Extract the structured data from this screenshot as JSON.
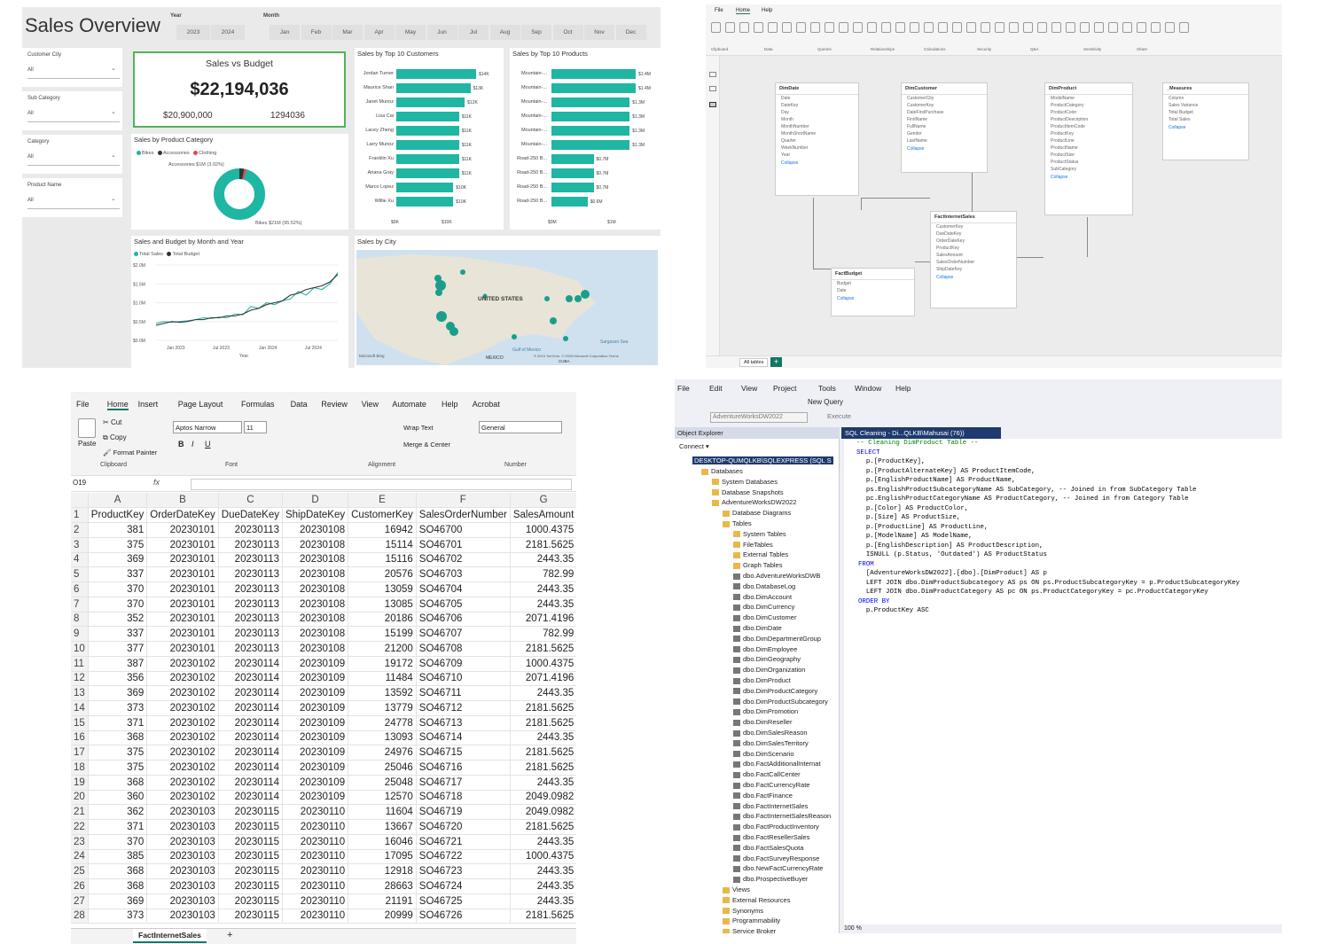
{
  "powerbi": {
    "title": "Sales Overview",
    "slicers": {
      "year_label": "Year",
      "years": [
        "2023",
        "2024"
      ],
      "month_label": "Month",
      "months": [
        "Jan",
        "Feb",
        "Mar",
        "Apr",
        "May",
        "Jun",
        "Jul",
        "Aug",
        "Sep",
        "Oct",
        "Nov",
        "Dec"
      ],
      "filters": [
        {
          "label": "Customer City",
          "value": "All"
        },
        {
          "label": "Sub Category",
          "value": "All"
        },
        {
          "label": "Category",
          "value": "All"
        },
        {
          "label": "Product Name",
          "value": "All"
        }
      ]
    },
    "kpi": {
      "title": "Sales vs Budget",
      "sales": "$22,194,036",
      "budget": "$20,900,000",
      "budget_raw": "1294036"
    },
    "donut": {
      "title": "Sales by Product Category",
      "legend": [
        "Bikes",
        "Accessories",
        "Clothing"
      ],
      "legend_colors": [
        "#1fb6a3",
        "#333333",
        "#e5484d"
      ],
      "label_acc": "Accessories $1M (3.02%)",
      "label_bikes": "Bikes $21M (95.52%)"
    },
    "customers": {
      "title": "Sales by Top 10 Customers",
      "names": [
        "Jordan Turner",
        "Maurice Shan",
        "Janet Munoz",
        "Lisa Cai",
        "Lacey Zheng",
        "Larry Munoz",
        "Franklin Xu",
        "Ariana Gray",
        "Marco Lopez",
        "Willie Xu"
      ],
      "values_k": [
        14,
        13,
        12,
        11,
        11,
        11,
        11,
        11,
        10,
        10
      ],
      "labels": [
        "$14K",
        "$13K",
        "$12K",
        "$11K",
        "$11K",
        "$11K",
        "$11K",
        "$11K",
        "$10K",
        "$10K"
      ],
      "ticks": [
        "$0K",
        "$10K"
      ]
    },
    "products": {
      "title": "Sales by Top 10 Products",
      "names": [
        "Mountain-...",
        "Mountain-...",
        "Mountain-...",
        "Mountain-...",
        "Mountain-...",
        "Mountain-...",
        "Road-250 B...",
        "Road-250 B...",
        "Road-250 B...",
        "Road-250 B..."
      ],
      "values_m": [
        1.4,
        1.4,
        1.3,
        1.3,
        1.3,
        1.3,
        0.7,
        0.7,
        0.7,
        0.6
      ],
      "labels": [
        "$1.4M",
        "$1.4M",
        "$1.3M",
        "$1.3M",
        "$1.3M",
        "$1.3M",
        "$0.7M",
        "$0.7M",
        "$0.7M",
        "$0.6M"
      ],
      "ticks": [
        "$0M",
        "$1M"
      ]
    },
    "line": {
      "title": "Sales and Budget by Month and Year",
      "legend": [
        "Total Sales",
        "Total Budget"
      ],
      "legend_colors": [
        "#1fb6a3",
        "#333333"
      ],
      "y_ticks": [
        "$2.0M",
        "$1.5M",
        "$1.0M",
        "$0.5M",
        "$0.0M"
      ],
      "x_ticks": [
        "Jan 2023",
        "Jul 2023",
        "Jan 2024",
        "Jul 2024"
      ],
      "xlabel": "Year"
    },
    "map": {
      "title": "Sales by City",
      "country": "UNITED STATES",
      "gulf": "Gulf of Mexico",
      "mexico": "MEXICO",
      "cuba": "CUBA",
      "sea": "Sargasso Sea",
      "credit": "© 2024 TomTom, © 2025 Microsoft Corporation  Terms",
      "brand": "Microsoft Bing"
    }
  },
  "chart_data": [
    {
      "type": "bar",
      "title": "Sales by Top 10 Customers",
      "categories": [
        "Jordan Turner",
        "Maurice Shan",
        "Janet Munoz",
        "Lisa Cai",
        "Lacey Zheng",
        "Larry Munoz",
        "Franklin Xu",
        "Ariana Gray",
        "Marco Lopez",
        "Willie Xu"
      ],
      "values": [
        14,
        13,
        12,
        11,
        11,
        11,
        11,
        11,
        10,
        10
      ]
    },
    {
      "type": "bar",
      "title": "Sales by Top 10 Products",
      "values": [
        1.4,
        1.4,
        1.3,
        1.3,
        1.3,
        1.3,
        0.7,
        0.7,
        0.7,
        0.6
      ]
    },
    {
      "type": "line",
      "title": "Sales and Budget by Month and Year",
      "ylim": [
        0,
        2.0
      ],
      "series": [
        {
          "name": "Total Sales",
          "values": [
            0.45,
            0.5,
            0.48,
            0.5,
            0.52,
            0.55,
            0.6,
            0.58,
            0.62,
            0.6,
            0.7,
            0.68,
            0.9,
            0.85,
            1.0,
            0.95,
            1.05,
            1.1,
            1.3,
            1.2,
            1.4,
            1.35,
            1.5,
            1.8
          ]
        },
        {
          "name": "Total Budget",
          "values": [
            0.4,
            0.45,
            0.5,
            0.48,
            0.5,
            0.55,
            0.55,
            0.6,
            0.6,
            0.65,
            0.65,
            0.7,
            0.8,
            0.85,
            0.95,
            1.0,
            1.05,
            1.2,
            1.25,
            1.35,
            1.4,
            1.45,
            1.55,
            1.75
          ]
        }
      ]
    },
    {
      "type": "pie",
      "title": "Sales by Product Category",
      "categories": [
        "Bikes",
        "Accessories",
        "Clothing"
      ],
      "values": [
        95.52,
        3.02,
        1.46
      ]
    }
  ],
  "model": {
    "tabs": [
      "File",
      "Home",
      "Help"
    ],
    "groups": [
      "Clipboard",
      "Data",
      "Queries",
      "Relationships",
      "Calculations",
      "Security",
      "Q&A",
      "Sensitivity",
      "Share"
    ],
    "tables": [
      {
        "name": "DimDate",
        "fields": [
          "Date",
          "DateKey",
          "Day",
          "Month",
          "MonthNumber",
          "MonthShortName",
          "Quarter",
          "WeekNumber",
          "Year"
        ]
      },
      {
        "name": "DimCustomer",
        "fields": [
          "CustomerCity",
          "CustomerKey",
          "DateFirstPurchase",
          "FirstName",
          "FullName",
          "Gender",
          "LastName"
        ]
      },
      {
        "name": "DimProduct",
        "fields": [
          "ModelName",
          "ProductCategory",
          "ProductColor",
          "ProductDescription",
          "ProductItemCode",
          "ProductKey",
          "ProductLine",
          "ProductName",
          "ProductSize",
          "ProductStatus",
          "SubCategory"
        ]
      },
      {
        "name": "_Measures",
        "fields": [
          "Column",
          "Sales Variance",
          "Total Budget",
          "Total Sales"
        ]
      },
      {
        "name": "FactInternetSales",
        "fields": [
          "CustomerKey",
          "DueDateKey",
          "OrderDateKey",
          "ProductKey",
          "SalesAmount",
          "SalesOrderNumber",
          "ShipDateKey"
        ]
      },
      {
        "name": "FactBudget",
        "fields": [
          "Budget",
          "Date"
        ]
      }
    ],
    "collapse": "Collapse",
    "footer_tab": "All tables"
  },
  "excel": {
    "menu": [
      "File",
      "Home",
      "Insert",
      "Page Layout",
      "Formulas",
      "Data",
      "Review",
      "View",
      "Automate",
      "Help",
      "Acrobat"
    ],
    "font": "Aptos Narrow",
    "size": "11",
    "numfmt": "General",
    "cellref": "O19",
    "clipboard": [
      "Cut",
      "Copy",
      "Format Painter",
      "Paste",
      "Clipboard"
    ],
    "groups": [
      "Font",
      "Alignment",
      "Number"
    ],
    "wrap": "Wrap Text",
    "merge": "Merge & Center",
    "cols": [
      "A",
      "B",
      "C",
      "D",
      "E",
      "F",
      "G"
    ],
    "headers": [
      "ProductKey",
      "OrderDateKey",
      "DueDateKey",
      "ShipDateKey",
      "CustomerKey",
      "SalesOrderNumber",
      "SalesAmount"
    ],
    "rows": [
      [
        "381",
        "20230101",
        "20230113",
        "20230108",
        "16942",
        "SO46700",
        "1000.4375"
      ],
      [
        "375",
        "20230101",
        "20230113",
        "20230108",
        "15114",
        "SO46701",
        "2181.5625"
      ],
      [
        "369",
        "20230101",
        "20230113",
        "20230108",
        "15116",
        "SO46702",
        "2443.35"
      ],
      [
        "337",
        "20230101",
        "20230113",
        "20230108",
        "20576",
        "SO46703",
        "782.99"
      ],
      [
        "370",
        "20230101",
        "20230113",
        "20230108",
        "13059",
        "SO46704",
        "2443.35"
      ],
      [
        "370",
        "20230101",
        "20230113",
        "20230108",
        "13085",
        "SO46705",
        "2443.35"
      ],
      [
        "352",
        "20230101",
        "20230113",
        "20230108",
        "20186",
        "SO46706",
        "2071.4196"
      ],
      [
        "337",
        "20230101",
        "20230113",
        "20230108",
        "15199",
        "SO46707",
        "782.99"
      ],
      [
        "377",
        "20230101",
        "20230113",
        "20230108",
        "21200",
        "SO46708",
        "2181.5625"
      ],
      [
        "387",
        "20230102",
        "20230114",
        "20230109",
        "19172",
        "SO46709",
        "1000.4375"
      ],
      [
        "356",
        "20230102",
        "20230114",
        "20230109",
        "11484",
        "SO46710",
        "2071.4196"
      ],
      [
        "369",
        "20230102",
        "20230114",
        "20230109",
        "13592",
        "SO46711",
        "2443.35"
      ],
      [
        "373",
        "20230102",
        "20230114",
        "20230109",
        "13779",
        "SO46712",
        "2181.5625"
      ],
      [
        "371",
        "20230102",
        "20230114",
        "20230109",
        "24778",
        "SO46713",
        "2181.5625"
      ],
      [
        "368",
        "20230102",
        "20230114",
        "20230109",
        "13093",
        "SO46714",
        "2443.35"
      ],
      [
        "375",
        "20230102",
        "20230114",
        "20230109",
        "24976",
        "SO46715",
        "2181.5625"
      ],
      [
        "375",
        "20230102",
        "20230114",
        "20230109",
        "25046",
        "SO46716",
        "2181.5625"
      ],
      [
        "368",
        "20230102",
        "20230114",
        "20230109",
        "25048",
        "SO46717",
        "2443.35"
      ],
      [
        "360",
        "20230102",
        "20230114",
        "20230109",
        "12570",
        "SO46718",
        "2049.0982"
      ],
      [
        "362",
        "20230103",
        "20230115",
        "20230110",
        "11604",
        "SO46719",
        "2049.0982"
      ],
      [
        "371",
        "20230103",
        "20230115",
        "20230110",
        "13667",
        "SO46720",
        "2181.5625"
      ],
      [
        "370",
        "20230103",
        "20230115",
        "20230110",
        "16046",
        "SO46721",
        "2443.35"
      ],
      [
        "385",
        "20230103",
        "20230115",
        "20230110",
        "17095",
        "SO46722",
        "1000.4375"
      ],
      [
        "368",
        "20230103",
        "20230115",
        "20230110",
        "12918",
        "SO46723",
        "2443.35"
      ],
      [
        "368",
        "20230103",
        "20230115",
        "20230110",
        "28663",
        "SO46724",
        "2443.35"
      ],
      [
        "369",
        "20230103",
        "20230115",
        "20230110",
        "21191",
        "SO46725",
        "2443.35"
      ],
      [
        "373",
        "20230103",
        "20230115",
        "20230110",
        "20999",
        "SO46726",
        "2181.5625"
      ]
    ],
    "sheet": "FactInternetSales"
  },
  "ssms": {
    "menu": [
      "File",
      "Edit",
      "View",
      "Project",
      "Tools",
      "Window",
      "Help"
    ],
    "newquery": "New Query",
    "execute": "Execute",
    "db": "AdventureWorksDW2022",
    "oe_title": "Object Explorer",
    "connect": "Connect ▾",
    "tab": "SQL Cleaning - Di...QLKB\\Mahusai (76))",
    "server": "DESKTOP-QUMQLKB\\SQLEXPRESS (SQL S",
    "tree": [
      "Databases",
      "System Databases",
      "Database Snapshots",
      "AdventureWorksDW2022",
      "Database Diagrams",
      "Tables",
      "System Tables",
      "FileTables",
      "External Tables",
      "Graph Tables",
      "dbo.AdventureWorksDWB",
      "dbo.DatabaseLog",
      "dbo.DimAccount",
      "dbo.DimCurrency",
      "dbo.DimCustomer",
      "dbo.DimDate",
      "dbo.DimDepartmentGroup",
      "dbo.DimEmployee",
      "dbo.DimGeography",
      "dbo.DimOrganization",
      "dbo.DimProduct",
      "dbo.DimProductCategory",
      "dbo.DimProductSubcategory",
      "dbo.DimPromotion",
      "dbo.DimReseller",
      "dbo.DimSalesReason",
      "dbo.DimSalesTerritory",
      "dbo.DimScenario",
      "dbo.FactAdditionalInternat",
      "dbo.FactCallCenter",
      "dbo.FactCurrencyRate",
      "dbo.FactFinance",
      "dbo.FactInternetSales",
      "dbo.FactInternetSalesReason",
      "dbo.FactProductInventory",
      "dbo.FactResellerSales",
      "dbo.FactSalesQuota",
      "dbo.FactSurveyResponse",
      "dbo.NewFactCurrencyRate",
      "dbo.ProspectiveBuyer",
      "Views",
      "External Resources",
      "Synonyms",
      "Programmability",
      "Service Broker"
    ],
    "zoom": "100 %",
    "code": [
      "-- Cleaning DimProduct Table --",
      "SELECT",
      "  p.[ProductKey],",
      "  p.[ProductAlternateKey] AS ProductItemCode,",
      "  p.[EnglishProductName] AS ProductName,",
      "  ps.EnglishProductSubcategoryName AS SubCategory, -- Joined in from SubCategory Table",
      "  pc.EnglishProductCategoryName AS ProductCategory, -- Joined in from Category Table",
      "  p.[Color] AS ProductColor,",
      "  p.[Size] AS ProductSize,",
      "  p.[ProductLine] AS ProductLine,",
      "  p.[ModelName] AS ModelName,",
      "  p.[EnglishDescription] AS ProductDescription,",
      "  ISNULL (p.Status, 'Outdated') AS ProductStatus",
      "FROM",
      "  [AdventureWorksDW2022].[dbo].[DimProduct] AS p",
      "  LEFT JOIN dbo.DimProductSubcategory AS ps ON ps.ProductSubcategoryKey = p.ProductSubcategoryKey",
      "  LEFT JOIN dbo.DimProductCategory AS pc ON ps.ProductCategoryKey = pc.ProductCategoryKey",
      "ORDER BY",
      "  p.ProductKey ASC"
    ]
  }
}
